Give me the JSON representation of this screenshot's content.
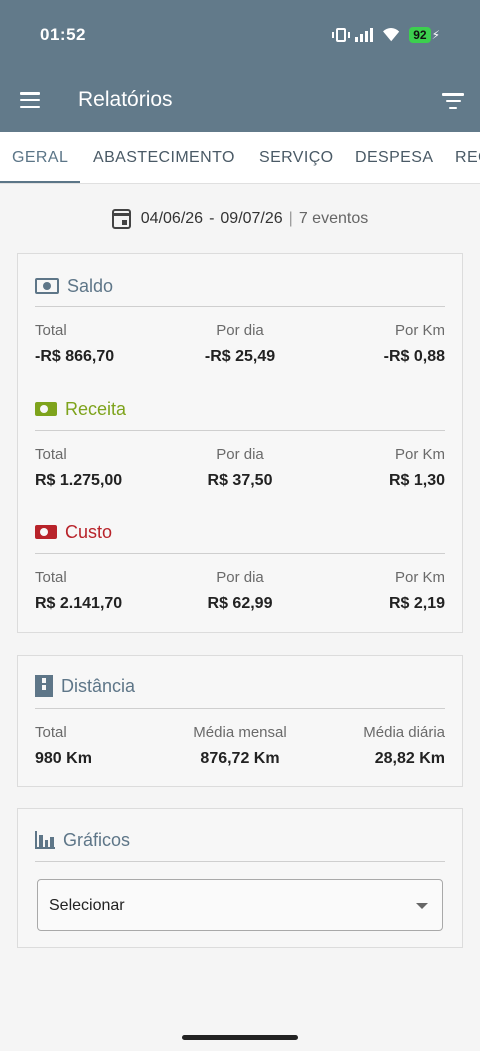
{
  "status_bar": {
    "time": "01:52",
    "battery": "92"
  },
  "app_bar": {
    "title": "Relatórios"
  },
  "tabs": [
    {
      "label": "GERAL"
    },
    {
      "label": "ABASTECIMENTO"
    },
    {
      "label": "SERVIÇO"
    },
    {
      "label": "DESPESA"
    },
    {
      "label": "REC"
    }
  ],
  "period": {
    "start": "04/06/26",
    "dash": "-",
    "end": "09/07/26",
    "separator": "|",
    "events": "7 eventos"
  },
  "summary": {
    "saldo": {
      "title": "Saldo",
      "stats": [
        {
          "label": "Total",
          "value": "-R$ 866,70"
        },
        {
          "label": "Por dia",
          "value": "-R$ 25,49"
        },
        {
          "label": "Por Km",
          "value": "-R$ 0,88"
        }
      ]
    },
    "receita": {
      "title": "Receita",
      "stats": [
        {
          "label": "Total",
          "value": "R$ 1.275,00"
        },
        {
          "label": "Por dia",
          "value": "R$ 37,50"
        },
        {
          "label": "Por Km",
          "value": "R$ 1,30"
        }
      ]
    },
    "custo": {
      "title": "Custo",
      "stats": [
        {
          "label": "Total",
          "value": "R$ 2.141,70"
        },
        {
          "label": "Por dia",
          "value": "R$ 62,99"
        },
        {
          "label": "Por Km",
          "value": "R$ 2,19"
        }
      ]
    }
  },
  "distancia": {
    "title": "Distância",
    "stats": [
      {
        "label": "Total",
        "value": "980 Km"
      },
      {
        "label": "Média mensal",
        "value": "876,72 Km"
      },
      {
        "label": "Média diária",
        "value": "28,82 Km"
      }
    ]
  },
  "graficos": {
    "title": "Gráficos",
    "select_value": "Selecionar"
  },
  "colors": {
    "appbar": "#627a8a",
    "saldo": "#5e7688",
    "receita": "#7ea31c",
    "custo": "#b8232a"
  },
  "icons": [
    "menu-icon",
    "filter-icon",
    "calendar-icon",
    "money-icon",
    "cash-plus-icon",
    "cash-minus-icon",
    "road-icon",
    "bar-chart-icon",
    "caret-down-icon"
  ]
}
